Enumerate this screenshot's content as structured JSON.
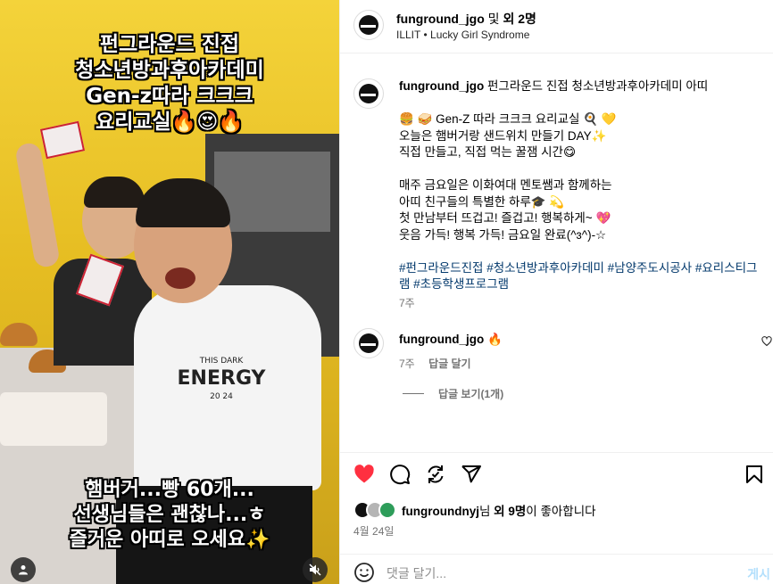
{
  "media": {
    "caption_top": [
      "펀그라운드 진접",
      "청소년방과후아카데미",
      "Gen-z따라 크크크",
      "요리교실🔥😍🔥"
    ],
    "caption_bottom": [
      "햄버거...빵 60개...",
      "선생님들은 괜찮나...ㅎ",
      "즐거운 아띠로 오세요✨"
    ],
    "shirt_text": [
      "THIS DARK",
      "ENERGY",
      "20    24"
    ],
    "user_icon": "user-icon",
    "mute_icon": "speaker-muted-icon"
  },
  "header": {
    "username": "funground_jgo",
    "joiner": "및",
    "others": "외 2명",
    "audio": "ILLIT",
    "separator": "•",
    "song": "Lucky Girl Syndrome",
    "more_icon": "more-options-icon"
  },
  "caption": {
    "username": "funground_jgo",
    "title": "펀그라운드 진접 청소년방과후아카데미 아띠",
    "lines": [
      "🍔 🥪  Gen-Z 따라 크크크 요리교실 🍳 💛",
      "오늘은 햄버거랑 샌드위치 만들기 DAY✨",
      "직접 만들고, 직접 먹는 꿀잼 시간😋",
      "",
      "매주 금요일은 이화여대 멘토쌤과 함께하는",
      "아띠 친구들의 특별한 하루🎓 💫",
      "첫 만남부터 뜨겁고! 즐겁고! 행복하게~ 💖",
      "웃음 가득! 행복 가득! 금요일 완료(^ɜ^)-☆"
    ],
    "tags_line1": "#펀그라운드진접 #청소년방과후아카데미 #남양주도시공사 #요리스티그",
    "tags_line2": "램 #초등학생프로그램",
    "time": "7주"
  },
  "comment": {
    "username": "funground_jgo",
    "text": "🔥",
    "time": "7주",
    "reply_label": "답글 달기",
    "view_replies": "답글 보기(1개)"
  },
  "actions": {
    "liked_by_user": "fungroundnyj",
    "liked_suffix1": "님",
    "liked_others": "외 9명",
    "liked_suffix2": "이 좋아합니다",
    "date": "4월 24일"
  },
  "comment_box": {
    "placeholder": "댓글 달기...",
    "post_label": "게시"
  },
  "colors": {
    "like_red": "#ff3040",
    "link_blue": "#00376b",
    "post_disabled": "#b2dffc",
    "muted_text": "#737373"
  }
}
